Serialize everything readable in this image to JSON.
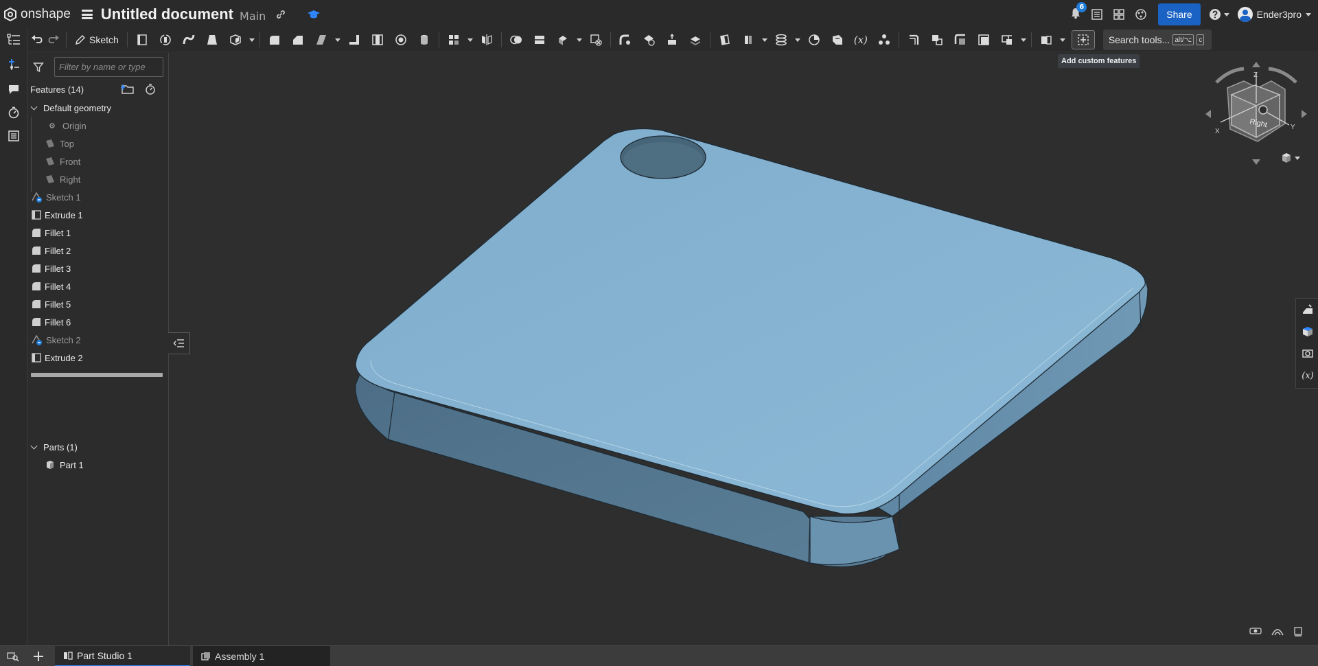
{
  "app": {
    "logo_text": "onshape",
    "document_title": "Untitled document",
    "branch": "Main"
  },
  "topbar": {
    "notification_count": "6",
    "share_label": "Share",
    "user_name": "Ender3pro"
  },
  "toolbar": {
    "sketch_label": "Sketch",
    "search_tools_label": "Search tools...",
    "search_shortcut_mod": "alt/⌥",
    "search_shortcut_key": "c",
    "tooltip": "Add custom features"
  },
  "feature_panel": {
    "filter_placeholder": "Filter by name or type",
    "features_header": "Features (14)",
    "default_geometry": "Default geometry",
    "geometry_items": [
      "Origin",
      "Top",
      "Front",
      "Right"
    ],
    "features": [
      {
        "label": "Sketch 1",
        "type": "sketch",
        "state": "dim"
      },
      {
        "label": "Extrude 1",
        "type": "extrude",
        "state": "bright"
      },
      {
        "label": "Fillet 1",
        "type": "fillet",
        "state": "bright"
      },
      {
        "label": "Fillet 2",
        "type": "fillet",
        "state": "bright"
      },
      {
        "label": "Fillet 3",
        "type": "fillet",
        "state": "bright"
      },
      {
        "label": "Fillet 4",
        "type": "fillet",
        "state": "bright"
      },
      {
        "label": "Fillet 5",
        "type": "fillet",
        "state": "bright"
      },
      {
        "label": "Fillet 6",
        "type": "fillet",
        "state": "bright"
      },
      {
        "label": "Sketch 2",
        "type": "sketch",
        "state": "dim"
      },
      {
        "label": "Extrude 2",
        "type": "extrude",
        "state": "bright"
      }
    ],
    "parts_header": "Parts (1)",
    "parts": [
      "Part 1"
    ]
  },
  "viewcube": {
    "face_label": "Right",
    "axis_x": "X",
    "axis_y": "Y",
    "axis_z": "Z"
  },
  "tabs": [
    {
      "label": "Part Studio 1",
      "active": true
    },
    {
      "label": "Assembly 1",
      "active": false
    }
  ],
  "colors": {
    "part_top": "#8ab4d0",
    "part_side": "#577a93",
    "accent": "#1a63c4",
    "background": "#2e2e2e"
  }
}
